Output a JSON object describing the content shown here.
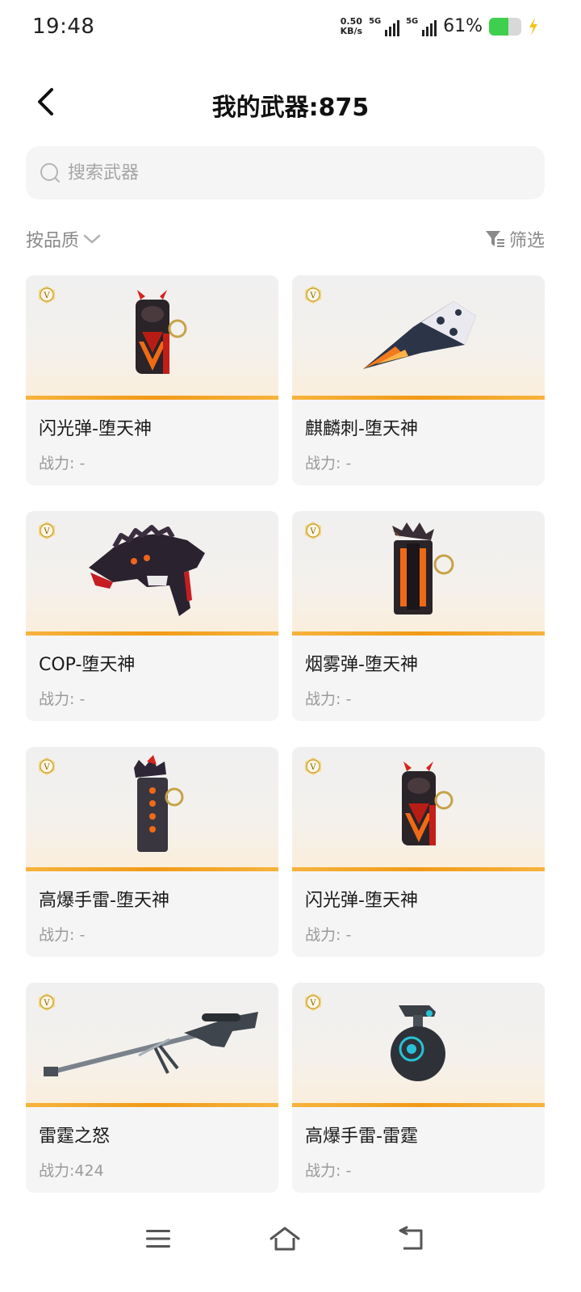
{
  "status_bar": {
    "time": "19:48",
    "net_speed_value": "0.50",
    "net_speed_unit": "KB/s",
    "sim1_label": "5G",
    "sim2_label": "5G",
    "battery_percent": "61%",
    "battery_level": 0.61,
    "battery_color": "#3fcf4e",
    "charging_color": "#f2c418"
  },
  "header": {
    "back_icon": "chevron-left-icon",
    "title": "我的武器:875"
  },
  "search": {
    "placeholder": "搜索武器",
    "value": ""
  },
  "filters": {
    "sort_label": "按品质",
    "filter_label": "筛选"
  },
  "colors": {
    "accent_bar": "#f19a17",
    "card_bg": "#f5f5f5"
  },
  "weapons": [
    {
      "name": "闪光弹-堕天神",
      "power": "战力: -",
      "badge": "V",
      "icon": "flashbang-grenade-image"
    },
    {
      "name": "麒麟刺-堕天神",
      "power": "战力: -",
      "badge": "V",
      "icon": "melee-blade-image"
    },
    {
      "name": "COP-堕天神",
      "power": "战力: -",
      "badge": "V",
      "icon": "pistol-image"
    },
    {
      "name": "烟雾弹-堕天神",
      "power": "战力: -",
      "badge": "V",
      "icon": "smoke-grenade-image"
    },
    {
      "name": "高爆手雷-堕天神",
      "power": "战力: -",
      "badge": "V",
      "icon": "he-grenade-image"
    },
    {
      "name": "闪光弹-堕天神",
      "power": "战力: -",
      "badge": "V",
      "icon": "flashbang-grenade-image"
    },
    {
      "name": "雷霆之怒",
      "power": "战力:424",
      "badge": "V",
      "icon": "sniper-rifle-image"
    },
    {
      "name": "高爆手雷-雷霆",
      "power": "战力: -",
      "badge": "V",
      "icon": "round-grenade-image"
    }
  ],
  "nav": {
    "menu_icon": "menu-icon",
    "home_icon": "home-icon",
    "back_icon": "back-icon"
  }
}
